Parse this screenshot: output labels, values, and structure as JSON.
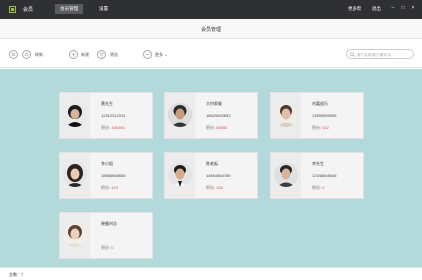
{
  "titlebar": {
    "app_name": "会员",
    "tabs": [
      "会员管理",
      "设置"
    ],
    "links": [
      "更多帮",
      "退出"
    ]
  },
  "page": {
    "title": "会员管理"
  },
  "toolbar": {
    "refresh_label": "刷新",
    "new_label": "新建",
    "filter_label": "筛选",
    "more_label": "更多",
    "search_placeholder": "客户名称/客户编号/手..."
  },
  "members": [
    {
      "name": "黄先生",
      "phone": "12312312312",
      "points_label": "积分:",
      "points": "456456"
    },
    {
      "name": "大何郭美",
      "phone": "18629592653",
      "points_label": "积分:",
      "points": "55555"
    },
    {
      "name": "刘嘉遥乐",
      "phone": "13595959595",
      "points_label": "积分:",
      "points": "522"
    },
    {
      "name": "李小姐",
      "phone": "18566565656",
      "points_label": "积分:",
      "points": "429"
    },
    {
      "name": "陈老板",
      "phone": "14564564789",
      "points_label": "积分:",
      "points": "330"
    },
    {
      "name": "李先生",
      "phone": "12345645645",
      "points_label": "积分:",
      "points": "0"
    },
    {
      "name": "晓霸刘总",
      "phone": "",
      "points_label": "积分:",
      "points": "0"
    }
  ],
  "status": {
    "text": "总数：7"
  },
  "colors": {
    "titlebar": "#2f3033",
    "content_bg": "#b3d9da",
    "points": "#e05050",
    "logo": "#9bc54a"
  }
}
